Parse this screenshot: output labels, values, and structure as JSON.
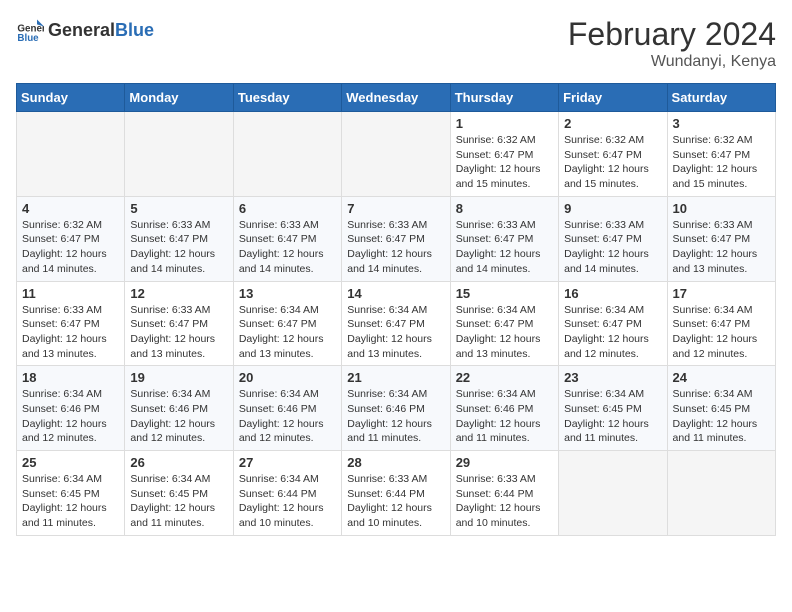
{
  "header": {
    "logo_general": "General",
    "logo_blue": "Blue",
    "month_title": "February 2024",
    "location": "Wundanyi, Kenya"
  },
  "weekdays": [
    "Sunday",
    "Monday",
    "Tuesday",
    "Wednesday",
    "Thursday",
    "Friday",
    "Saturday"
  ],
  "weeks": [
    [
      {
        "day": "",
        "info": ""
      },
      {
        "day": "",
        "info": ""
      },
      {
        "day": "",
        "info": ""
      },
      {
        "day": "",
        "info": ""
      },
      {
        "day": "1",
        "info": "Sunrise: 6:32 AM\nSunset: 6:47 PM\nDaylight: 12 hours and 15 minutes."
      },
      {
        "day": "2",
        "info": "Sunrise: 6:32 AM\nSunset: 6:47 PM\nDaylight: 12 hours and 15 minutes."
      },
      {
        "day": "3",
        "info": "Sunrise: 6:32 AM\nSunset: 6:47 PM\nDaylight: 12 hours and 15 minutes."
      }
    ],
    [
      {
        "day": "4",
        "info": "Sunrise: 6:32 AM\nSunset: 6:47 PM\nDaylight: 12 hours and 14 minutes."
      },
      {
        "day": "5",
        "info": "Sunrise: 6:33 AM\nSunset: 6:47 PM\nDaylight: 12 hours and 14 minutes."
      },
      {
        "day": "6",
        "info": "Sunrise: 6:33 AM\nSunset: 6:47 PM\nDaylight: 12 hours and 14 minutes."
      },
      {
        "day": "7",
        "info": "Sunrise: 6:33 AM\nSunset: 6:47 PM\nDaylight: 12 hours and 14 minutes."
      },
      {
        "day": "8",
        "info": "Sunrise: 6:33 AM\nSunset: 6:47 PM\nDaylight: 12 hours and 14 minutes."
      },
      {
        "day": "9",
        "info": "Sunrise: 6:33 AM\nSunset: 6:47 PM\nDaylight: 12 hours and 14 minutes."
      },
      {
        "day": "10",
        "info": "Sunrise: 6:33 AM\nSunset: 6:47 PM\nDaylight: 12 hours and 13 minutes."
      }
    ],
    [
      {
        "day": "11",
        "info": "Sunrise: 6:33 AM\nSunset: 6:47 PM\nDaylight: 12 hours and 13 minutes."
      },
      {
        "day": "12",
        "info": "Sunrise: 6:33 AM\nSunset: 6:47 PM\nDaylight: 12 hours and 13 minutes."
      },
      {
        "day": "13",
        "info": "Sunrise: 6:34 AM\nSunset: 6:47 PM\nDaylight: 12 hours and 13 minutes."
      },
      {
        "day": "14",
        "info": "Sunrise: 6:34 AM\nSunset: 6:47 PM\nDaylight: 12 hours and 13 minutes."
      },
      {
        "day": "15",
        "info": "Sunrise: 6:34 AM\nSunset: 6:47 PM\nDaylight: 12 hours and 13 minutes."
      },
      {
        "day": "16",
        "info": "Sunrise: 6:34 AM\nSunset: 6:47 PM\nDaylight: 12 hours and 12 minutes."
      },
      {
        "day": "17",
        "info": "Sunrise: 6:34 AM\nSunset: 6:47 PM\nDaylight: 12 hours and 12 minutes."
      }
    ],
    [
      {
        "day": "18",
        "info": "Sunrise: 6:34 AM\nSunset: 6:46 PM\nDaylight: 12 hours and 12 minutes."
      },
      {
        "day": "19",
        "info": "Sunrise: 6:34 AM\nSunset: 6:46 PM\nDaylight: 12 hours and 12 minutes."
      },
      {
        "day": "20",
        "info": "Sunrise: 6:34 AM\nSunset: 6:46 PM\nDaylight: 12 hours and 12 minutes."
      },
      {
        "day": "21",
        "info": "Sunrise: 6:34 AM\nSunset: 6:46 PM\nDaylight: 12 hours and 11 minutes."
      },
      {
        "day": "22",
        "info": "Sunrise: 6:34 AM\nSunset: 6:46 PM\nDaylight: 12 hours and 11 minutes."
      },
      {
        "day": "23",
        "info": "Sunrise: 6:34 AM\nSunset: 6:45 PM\nDaylight: 12 hours and 11 minutes."
      },
      {
        "day": "24",
        "info": "Sunrise: 6:34 AM\nSunset: 6:45 PM\nDaylight: 12 hours and 11 minutes."
      }
    ],
    [
      {
        "day": "25",
        "info": "Sunrise: 6:34 AM\nSunset: 6:45 PM\nDaylight: 12 hours and 11 minutes."
      },
      {
        "day": "26",
        "info": "Sunrise: 6:34 AM\nSunset: 6:45 PM\nDaylight: 12 hours and 11 minutes."
      },
      {
        "day": "27",
        "info": "Sunrise: 6:34 AM\nSunset: 6:44 PM\nDaylight: 12 hours and 10 minutes."
      },
      {
        "day": "28",
        "info": "Sunrise: 6:33 AM\nSunset: 6:44 PM\nDaylight: 12 hours and 10 minutes."
      },
      {
        "day": "29",
        "info": "Sunrise: 6:33 AM\nSunset: 6:44 PM\nDaylight: 12 hours and 10 minutes."
      },
      {
        "day": "",
        "info": ""
      },
      {
        "day": "",
        "info": ""
      }
    ]
  ]
}
